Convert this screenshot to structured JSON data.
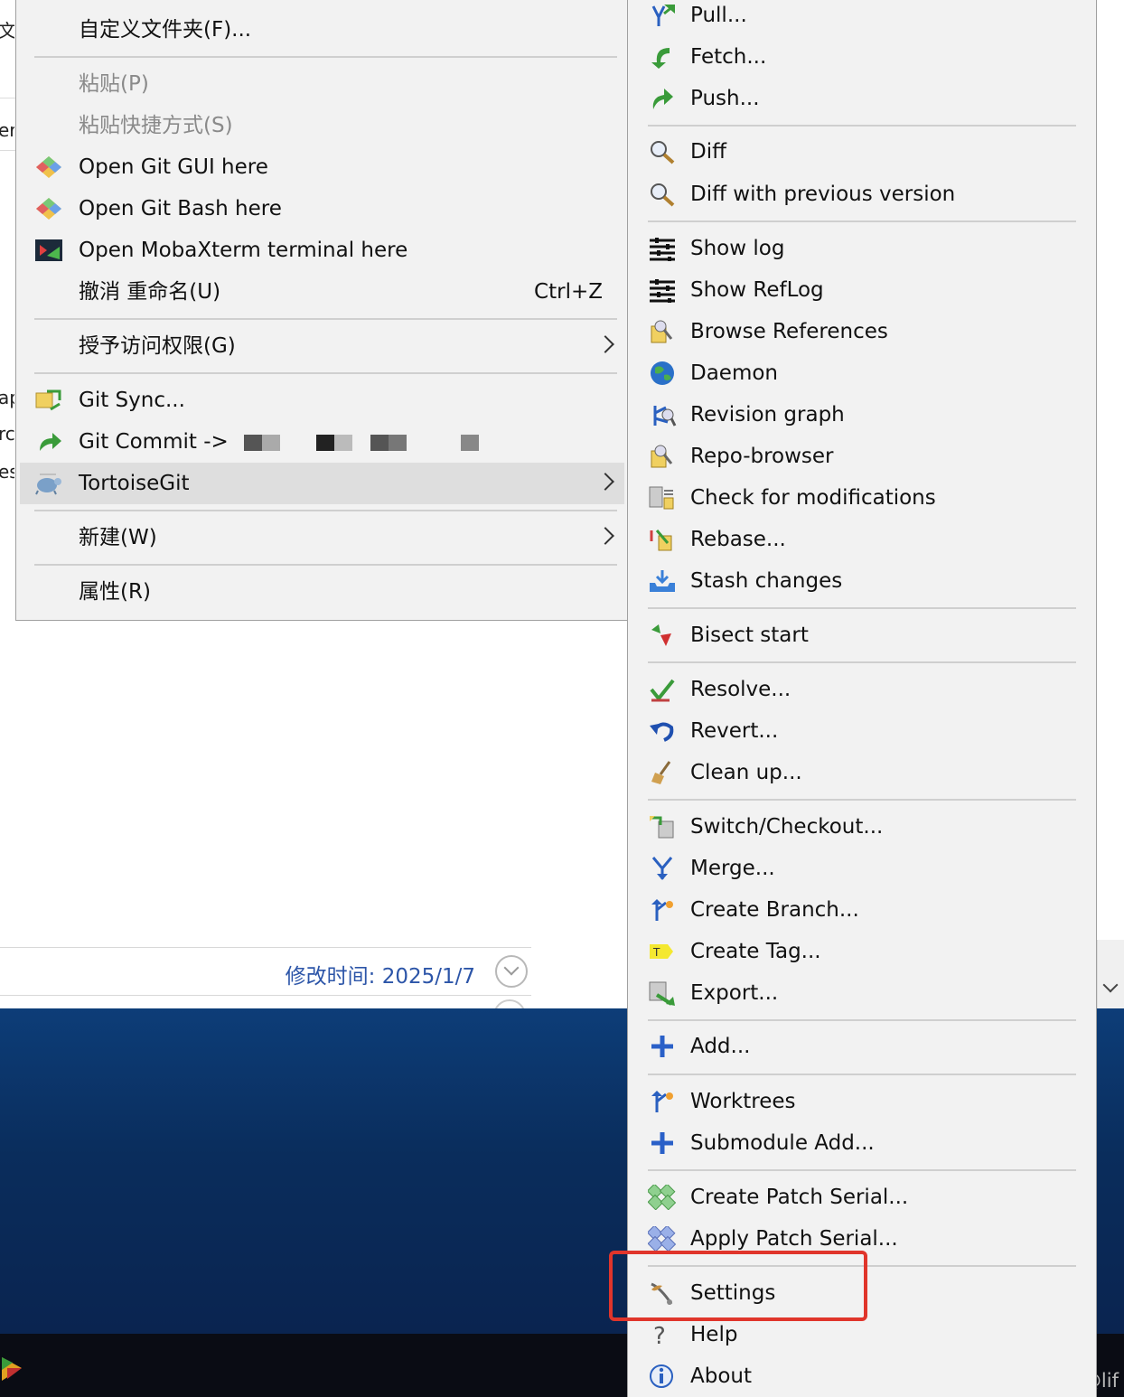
{
  "background": {
    "left_strip_fragments": [
      "文",
      "er",
      "ap",
      "rc",
      "es"
    ],
    "details_text": "修改时间:  2025/1/7",
    "watermark": "CSDN @lif"
  },
  "main_menu": {
    "items": [
      {
        "label": "自定义文件夹(F)...",
        "icon": ""
      },
      {
        "label": "粘贴(P)",
        "disabled": true
      },
      {
        "label": "粘贴快捷方式(S)",
        "disabled": true
      },
      {
        "label": "Open Git GUI here",
        "icon": "git-gui-icon"
      },
      {
        "label": "Open Git Bash here",
        "icon": "git-bash-icon"
      },
      {
        "label": "Open MobaXterm terminal here",
        "icon": "mobaxterm-icon"
      },
      {
        "label": "撤消 重命名(U)",
        "shortcut": "Ctrl+Z"
      },
      {
        "label": "授予访问权限(G)",
        "submenu": true
      },
      {
        "label": "Git Sync...",
        "icon": "git-sync-icon"
      },
      {
        "label": "Git Commit -> ",
        "icon": "git-commit-icon"
      },
      {
        "label": "TortoiseGit",
        "icon": "tortoisegit-icon",
        "submenu": true,
        "active": true
      },
      {
        "label": "新建(W)",
        "submenu": true
      },
      {
        "label": "属性(R)"
      }
    ]
  },
  "tortoise_submenu": {
    "items": [
      {
        "label": "Pull...",
        "icon": "pull-icon"
      },
      {
        "label": "Fetch...",
        "icon": "fetch-icon"
      },
      {
        "label": "Push...",
        "icon": "push-icon"
      },
      {
        "label": "Diff",
        "icon": "diff-icon"
      },
      {
        "label": "Diff with previous version",
        "icon": "diff-previous-icon"
      },
      {
        "label": "Show log",
        "icon": "show-log-icon"
      },
      {
        "label": "Show RefLog",
        "icon": "show-reflog-icon"
      },
      {
        "label": "Browse References",
        "icon": "browse-references-icon"
      },
      {
        "label": "Daemon",
        "icon": "daemon-globe-icon"
      },
      {
        "label": "Revision graph",
        "icon": "revision-graph-icon"
      },
      {
        "label": "Repo-browser",
        "icon": "repo-browser-icon"
      },
      {
        "label": "Check for modifications",
        "icon": "check-modifications-icon"
      },
      {
        "label": "Rebase...",
        "icon": "rebase-icon"
      },
      {
        "label": "Stash changes",
        "icon": "stash-icon"
      },
      {
        "label": "Bisect start",
        "icon": "bisect-icon"
      },
      {
        "label": "Resolve...",
        "icon": "resolve-icon"
      },
      {
        "label": "Revert...",
        "icon": "revert-icon"
      },
      {
        "label": "Clean up...",
        "icon": "cleanup-broom-icon"
      },
      {
        "label": "Switch/Checkout...",
        "icon": "switch-checkout-icon"
      },
      {
        "label": "Merge...",
        "icon": "merge-icon"
      },
      {
        "label": "Create Branch...",
        "icon": "create-branch-icon"
      },
      {
        "label": "Create Tag...",
        "icon": "create-tag-icon"
      },
      {
        "label": "Export...",
        "icon": "export-icon"
      },
      {
        "label": "Add...",
        "icon": "add-plus-icon"
      },
      {
        "label": "Worktrees",
        "icon": "worktrees-icon"
      },
      {
        "label": "Submodule Add...",
        "icon": "submodule-add-icon"
      },
      {
        "label": "Create Patch Serial...",
        "icon": "create-patch-icon"
      },
      {
        "label": "Apply Patch Serial...",
        "icon": "apply-patch-icon"
      },
      {
        "label": "Settings",
        "icon": "settings-tools-icon",
        "highlighted": true
      },
      {
        "label": "Help",
        "icon": "help-icon"
      },
      {
        "label": "About",
        "icon": "about-info-icon"
      }
    ]
  },
  "colors": {
    "menu_bg": "#f2f2f2",
    "hover_bg": "#dedede",
    "highlight_border": "#e0352b",
    "details_text": "#2c55a8",
    "desktop": "#0d3d78"
  }
}
